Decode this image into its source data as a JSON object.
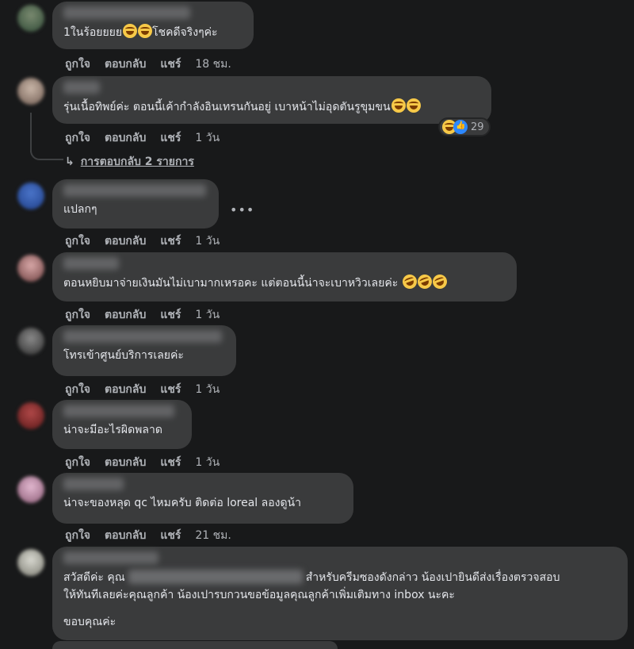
{
  "actions": {
    "like": "ถูกใจ",
    "reply": "ตอบกลับ",
    "share": "แชร์"
  },
  "comments": [
    {
      "text": "1ในร้อยยยย",
      "text_after": "โชคดีจริงๆค่ะ",
      "time": "18 ชม."
    },
    {
      "text": "รุ่นเนื้อทิพย์ค่ะ ตอนนี้เค้ากำลังอินเทรนกันอยู่ เบาหน้าไม่อุดตันรูขุมขน",
      "time": "1 วัน",
      "reaction_count": "29",
      "replies_link": "การตอบกลับ 2 รายการ"
    },
    {
      "text": "แปลกๆ",
      "time": "1 วัน",
      "more": "•••"
    },
    {
      "text": "ตอนหยิบมาจ่ายเงินมันไม่เบามากเหรอคะ แต่ตอนนี้น่าจะเบาหวิวเลยค่ะ",
      "time": "1 วัน"
    },
    {
      "text": "โทรเข้าศูนย์บริการเลยค่ะ",
      "time": "1 วัน"
    },
    {
      "text": "น่าจะมีอะไรผิดพลาด",
      "time": "1 วัน"
    },
    {
      "text": "น่าจะของหลุด qc ไหมครับ ติดต่อ loreal ลองดูน้า",
      "time": "21 ชม."
    },
    {
      "text_prefix": "สวัสดีค่ะ คุณ",
      "text_suffix": "สำหรับครีมซองดังกล่าว น้องเปายินดีส่งเรื่องตรวจสอบ",
      "text_line2": "ให้ทันทีเลยค่ะคุณลูกค้า น้องเปารบกวนขอข้อมูลคุณลูกค้าเพิ่มเติมทาง inbox นะคะ",
      "text_line3": "ขอบคุณค่ะ"
    }
  ],
  "colors": {
    "background": "#18191a",
    "bubble": "#3a3b3c",
    "text": "#e4e6eb",
    "muted": "#b0b3b8",
    "like_blue": "#2d88ff",
    "emoji_yellow": "#f7c948"
  },
  "icons": {
    "emoji": "grinning-squinting-face-icon",
    "laugh": "rolling-on-floor-laughing-icon",
    "like": "thumbs-up-icon",
    "reply_arrow": "reply-arrow-icon"
  }
}
